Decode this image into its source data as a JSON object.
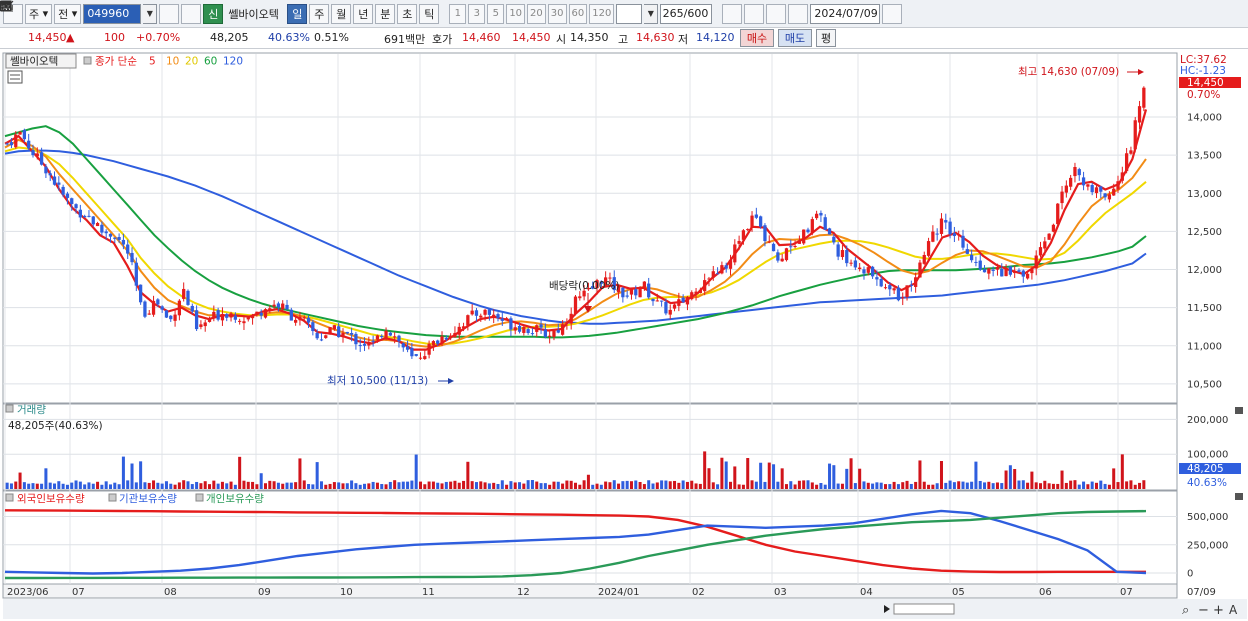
{
  "toolbar": {
    "market_label": "주",
    "range_label": "전",
    "stock_code": "049960",
    "new_badge": "신",
    "stock_name": "쎌바이오텍",
    "periods": [
      "일",
      "주",
      "월",
      "년",
      "분",
      "초",
      "틱"
    ],
    "active_period": "일",
    "intervals": [
      "1",
      "3",
      "5",
      "10",
      "20",
      "30",
      "60",
      "120"
    ],
    "count_value": "265",
    "count_total": "/600",
    "date_value": "2024/07/09"
  },
  "quote": {
    "price": "14,450",
    "change_arrow": "▲",
    "change": "100",
    "change_pct": "+0.70%",
    "volume": "48,205",
    "vol_ratio": "40.63%",
    "turnover": "0.51%",
    "amount": "691백만",
    "hoga_label": "호가",
    "ask": "14,460",
    "bid": "14,450",
    "open_label": "시",
    "open": "14,350",
    "high_label": "고",
    "high": "14,630",
    "low_label": "저",
    "low": "14,120",
    "buy_label": "매수",
    "sell_label": "매도",
    "avg_label": "평"
  },
  "price_panel": {
    "title": "쎌바이오텍",
    "ma_title": "종가 단순",
    "ma_periods": [
      "5",
      "10",
      "20",
      "60",
      "120"
    ],
    "ma_colors": [
      "#e51c1c",
      "#f28c16",
      "#f0d800",
      "#18a040",
      "#2f5ede"
    ],
    "lc_label": "LC:37.62",
    "hc_label": "HC:-1.23",
    "high_annotation": "최고 14,630 (07/09)",
    "low_annotation": "최저 10,500 (11/13)",
    "dividend_annotation": "배당락(0.00%)",
    "last_price_tag": "14,450",
    "last_pct_tag": "0.70%"
  },
  "volume_panel": {
    "title": "거래량",
    "current": "48,205주(40.63%)",
    "tag_value": "48,205",
    "tag_pct": "40.63%"
  },
  "holding_panel": {
    "legends": [
      "외국인보유수량",
      "기관보유수량",
      "개인보유수량"
    ],
    "colors": [
      "#e51c1c",
      "#2f5ede",
      "#2a9a58"
    ]
  },
  "chart_data": {
    "type": "candlestick",
    "y_ticks": [
      "10,500",
      "11,000",
      "11,500",
      "12,000",
      "12,500",
      "13,000",
      "13,500",
      "14,000"
    ],
    "y_range": [
      10250,
      14800
    ],
    "volume_ticks": [
      "100,000",
      "200,000"
    ],
    "volume_range": [
      0,
      230000
    ],
    "holding_ticks": [
      "0",
      "250,000",
      "500,000"
    ],
    "holding_range": [
      -80000,
      620000
    ],
    "x_labels": [
      "2023/06",
      "07",
      "08",
      "09",
      "10",
      "11",
      "12",
      "2024/01",
      "02",
      "03",
      "04",
      "05",
      "06",
      "07"
    ],
    "last_date": "07/09",
    "close_path": [
      13650,
      13800,
      13500,
      13300,
      13000,
      12800,
      12700,
      12500,
      12450,
      12200,
      11400,
      11600,
      11300,
      11750,
      11200,
      11350,
      11450,
      11400,
      11350,
      11500,
      11550,
      11400,
      11300,
      11100,
      11200,
      11150,
      11050,
      11000,
      11250,
      11050,
      10800,
      10950,
      11100,
      11200,
      11350,
      11450,
      11400,
      11300,
      11250,
      11200,
      11150,
      11250,
      11600,
      11700,
      11900,
      11750,
      11650,
      11800,
      11550,
      11450,
      11600,
      11750,
      11950,
      12050,
      12350,
      12700,
      12450,
      12150,
      12350,
      12500,
      12750,
      12300,
      12150,
      12050,
      11900,
      11750,
      11650,
      11900,
      12350,
      12600,
      12500,
      12250,
      12050,
      12000,
      11950,
      11900,
      12100,
      12450,
      13000,
      13300,
      13050,
      12950,
      13150,
      13600,
      14450
    ],
    "ma_series": [
      {
        "name": "5",
        "values": [
          13650,
          13750,
          13550,
          13350,
          13050,
          12800,
          12650,
          12450,
          12350,
          12050,
          11700,
          11550,
          11450,
          11500,
          11400,
          11350,
          11400,
          11400,
          11380,
          11450,
          11480,
          11420,
          11330,
          11180,
          11160,
          11120,
          11060,
          11030,
          11100,
          11060,
          10950,
          10950,
          11020,
          11130,
          11250,
          11350,
          11380,
          11340,
          11280,
          11230,
          11200,
          11220,
          11420,
          11580,
          11770,
          11800,
          11750,
          11760,
          11660,
          11560,
          11580,
          11690,
          11880,
          12020,
          12270,
          12560,
          12550,
          12320,
          12330,
          12420,
          12560,
          12480,
          12270,
          12130,
          11990,
          11830,
          11730,
          11820,
          12120,
          12420,
          12480,
          12360,
          12180,
          12060,
          11990,
          11940,
          12060,
          12350,
          12780,
          13120,
          13150,
          13050,
          13120,
          13450,
          14100
        ]
      },
      {
        "name": "10",
        "values": [
          13600,
          13700,
          13620,
          13480,
          13250,
          13050,
          12850,
          12650,
          12450,
          12250,
          11980,
          11760,
          11600,
          11520,
          11450,
          11400,
          11400,
          11390,
          11390,
          11420,
          11440,
          11430,
          11380,
          11300,
          11230,
          11170,
          11110,
          11070,
          11080,
          11060,
          11010,
          10990,
          11000,
          11050,
          11120,
          11200,
          11270,
          11310,
          11320,
          11300,
          11270,
          11280,
          11350,
          11460,
          11580,
          11680,
          11740,
          11770,
          11740,
          11680,
          11630,
          11640,
          11730,
          11840,
          12000,
          12200,
          12350,
          12400,
          12390,
          12400,
          12450,
          12460,
          12400,
          12320,
          12220,
          12100,
          11990,
          11940,
          11980,
          12090,
          12190,
          12250,
          12240,
          12180,
          12110,
          12040,
          12030,
          12110,
          12330,
          12600,
          12830,
          12970,
          13050,
          13200,
          13450
        ]
      },
      {
        "name": "20",
        "values": [
          13550,
          13600,
          13580,
          13500,
          13380,
          13200,
          13000,
          12800,
          12600,
          12400,
          12150,
          11950,
          11780,
          11650,
          11560,
          11490,
          11450,
          11420,
          11400,
          11400,
          11410,
          11410,
          11390,
          11350,
          11300,
          11250,
          11200,
          11150,
          11120,
          11100,
          11060,
          11030,
          11020,
          11030,
          11060,
          11100,
          11150,
          11200,
          11230,
          11250,
          11250,
          11260,
          11290,
          11340,
          11400,
          11470,
          11540,
          11600,
          11630,
          11640,
          11640,
          11660,
          11700,
          11770,
          11860,
          11980,
          12100,
          12200,
          12260,
          12300,
          12340,
          12370,
          12380,
          12370,
          12340,
          12290,
          12230,
          12170,
          12140,
          12140,
          12160,
          12190,
          12210,
          12210,
          12190,
          12160,
          12130,
          12140,
          12220,
          12380,
          12570,
          12740,
          12870,
          13000,
          13150
        ]
      },
      {
        "name": "60",
        "values": [
          13750,
          13800,
          13850,
          13880,
          13800,
          13650,
          13450,
          13250,
          13050,
          12850,
          12650,
          12450,
          12280,
          12120,
          11980,
          11860,
          11760,
          11680,
          11610,
          11550,
          11500,
          11460,
          11420,
          11380,
          11340,
          11300,
          11260,
          11230,
          11200,
          11180,
          11160,
          11140,
          11130,
          11120,
          11120,
          11120,
          11120,
          11120,
          11120,
          11120,
          11110,
          11110,
          11120,
          11130,
          11150,
          11170,
          11200,
          11230,
          11260,
          11290,
          11320,
          11350,
          11390,
          11430,
          11480,
          11530,
          11590,
          11650,
          11700,
          11750,
          11800,
          11840,
          11880,
          11920,
          11950,
          11980,
          11990,
          11990,
          11990,
          11990,
          11990,
          12000,
          12010,
          12020,
          12040,
          12060,
          12070,
          12080,
          12100,
          12130,
          12160,
          12200,
          12240,
          12300,
          12440
        ]
      },
      {
        "name": "120",
        "values": [
          13520,
          13550,
          13560,
          13560,
          13550,
          13530,
          13500,
          13460,
          13420,
          13370,
          13320,
          13270,
          13220,
          13160,
          13100,
          13030,
          12960,
          12880,
          12800,
          12720,
          12640,
          12560,
          12480,
          12400,
          12320,
          12240,
          12160,
          12080,
          12000,
          11920,
          11850,
          11780,
          11710,
          11640,
          11580,
          11520,
          11470,
          11430,
          11390,
          11360,
          11330,
          11310,
          11300,
          11290,
          11290,
          11300,
          11310,
          11320,
          11330,
          11350,
          11370,
          11390,
          11410,
          11430,
          11450,
          11470,
          11490,
          11510,
          11530,
          11550,
          11570,
          11580,
          11590,
          11600,
          11610,
          11620,
          11630,
          11640,
          11650,
          11660,
          11680,
          11700,
          11720,
          11740,
          11760,
          11780,
          11800,
          11830,
          11860,
          11900,
          11940,
          11980,
          12030,
          12080,
          12210
        ]
      }
    ],
    "holding_series": [
      {
        "name": "외국인보유수량",
        "values": [
          555000,
          554000,
          553000,
          551000,
          549000,
          547000,
          545000,
          543000,
          541000,
          539000,
          537000,
          535000,
          533000,
          531000,
          529000,
          527000,
          525000,
          522000,
          519000,
          516000,
          512000,
          508000,
          500000,
          470000,
          410000,
          330000,
          250000,
          190000,
          150000,
          110000,
          70000,
          40000,
          20000,
          12000,
          9000,
          9000,
          10000,
          10000,
          10000,
          10000
        ]
      },
      {
        "name": "기관보유수량",
        "values": [
          10000,
          5000,
          0,
          -5000,
          0,
          10000,
          20000,
          40000,
          70000,
          110000,
          150000,
          180000,
          210000,
          230000,
          250000,
          260000,
          270000,
          280000,
          290000,
          300000,
          310000,
          320000,
          340000,
          380000,
          420000,
          410000,
          400000,
          410000,
          420000,
          440000,
          480000,
          520000,
          550000,
          530000,
          460000,
          380000,
          300000,
          200000,
          10000,
          0
        ]
      },
      {
        "name": "개인보유수량",
        "values": [
          -45000,
          -45000,
          -44000,
          -44000,
          -43000,
          -43000,
          -42000,
          -42000,
          -41000,
          -41000,
          -40000,
          -40000,
          -39000,
          -38000,
          -37000,
          -36000,
          -35000,
          -30000,
          -20000,
          0,
          40000,
          90000,
          150000,
          200000,
          250000,
          290000,
          330000,
          360000,
          390000,
          410000,
          430000,
          450000,
          460000,
          470000,
          490000,
          510000,
          530000,
          540000,
          545000,
          548000
        ]
      }
    ]
  }
}
